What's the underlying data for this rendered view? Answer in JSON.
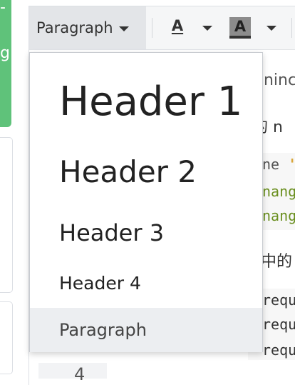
{
  "sidebar": {
    "top_glyphs": "- -",
    "mid_glyph": "g"
  },
  "toolbar": {
    "style_label": "Paragraph",
    "font_color_letter": "A",
    "background_color_letter": "A",
    "icons": {
      "style_caret": "chevron-down-icon",
      "font_color": "font-color-icon",
      "background_color": "background-color-icon"
    }
  },
  "dropdown": {
    "items": [
      {
        "label": "Header 1",
        "level": "h1"
      },
      {
        "label": "Header 2",
        "level": "h2"
      },
      {
        "label": "Header 3",
        "level": "h3"
      },
      {
        "label": "Header 4",
        "level": "h4"
      },
      {
        "label": "Paragraph",
        "level": "p",
        "selected": true
      }
    ]
  },
  "editor": {
    "line_1": "nninc",
    "line_2": "的 n",
    "code_1_pre": "ne ",
    "code_1_str": "'",
    "code_2": "nang",
    "code_3": "nang",
    "line_3": "中的",
    "code_4": "requ",
    "code_5": "requ",
    "code_6": "requ",
    "line_number": "4"
  },
  "colors": {
    "accent_green": "#5fc27a",
    "toolbar_bg": "#f5f6f7",
    "selected_bg": "#eceef1",
    "code_green": "#6a8f1f",
    "code_string": "#d9a63a"
  }
}
